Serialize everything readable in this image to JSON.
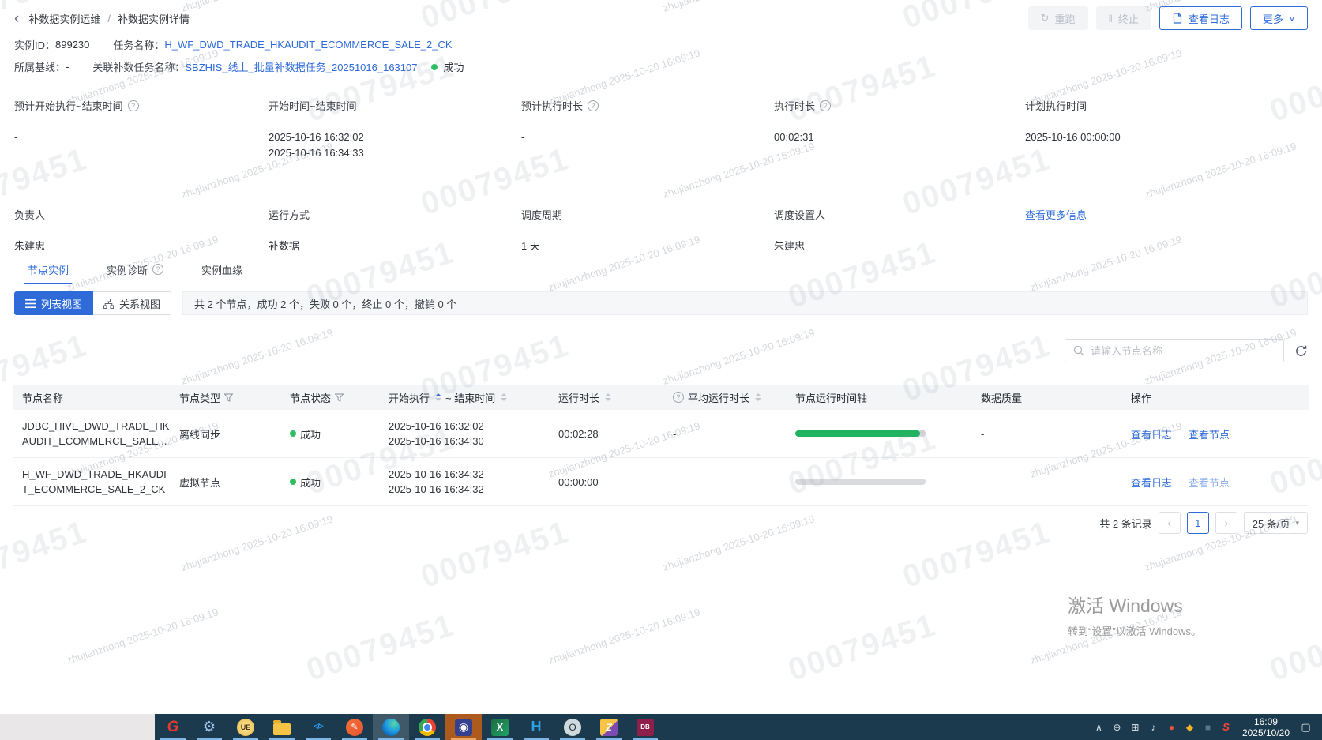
{
  "topbar": {
    "back_icon": "‹",
    "breadcrumb_section": "补数据实例运维",
    "breadcrumb_sep": "/",
    "breadcrumb_current": "补数据实例详情",
    "rerun_icon": "↻",
    "rerun_label": "重跑",
    "terminate_icon": "‖",
    "terminate_label": "终止",
    "view_log_label": "查看日志",
    "more_label": "更多",
    "more_caret": "∨"
  },
  "instance": {
    "id_label": "实例ID：",
    "id": "899230",
    "task_label": "任务名称：",
    "task_name": "H_WF_DWD_TRADE_HKAUDIT_ECOMMERCE_SALE_2_CK",
    "baseline_label": "所属基线：",
    "baseline": "-",
    "related_label": "关联补数任务名称：",
    "related_name": "SBZHIS_线上_批量补数据任务_20251016_163107",
    "status": "成功"
  },
  "info": {
    "help": "?",
    "more_link": "查看更多信息",
    "r1c1": {
      "label": "预计开始执行~结束时间",
      "v1": "-"
    },
    "r1c2": {
      "label": "开始时间~结束时间",
      "v1": "2025-10-16 16:32:02",
      "v2": "2025-10-16 16:34:33"
    },
    "r1c3": {
      "label": "预计执行时长",
      "v1": "-"
    },
    "r1c4": {
      "label": "执行时长",
      "v1": "00:02:31"
    },
    "r1c5": {
      "label": "计划执行时间",
      "v1": "2025-10-16 00:00:00"
    },
    "r2c1": {
      "label": "负责人",
      "v1": "朱建忠"
    },
    "r2c2": {
      "label": "运行方式",
      "v1": "补数据"
    },
    "r2c3": {
      "label": "调度周期",
      "v1": "1 天"
    },
    "r2c4": {
      "label": "调度设置人",
      "v1": "朱建忠"
    }
  },
  "tabs": {
    "t1": "节点实例",
    "t2": "实例诊断",
    "t3": "实例血缘",
    "help": "?"
  },
  "toolbar": {
    "list_view": "列表视图",
    "relation_view": "关系视图",
    "summary": "共 2 个节点，成功 2 个，失败 0 个，终止 0 个，撤销 0 个"
  },
  "search": {
    "placeholder": "请输入节点名称"
  },
  "table": {
    "h_name": "节点名称",
    "h_type": "节点类型",
    "h_status": "节点状态",
    "h_start": "开始执行",
    "h_end": "~ 结束时间",
    "h_duration": "运行时长",
    "h_avg": "平均运行时长",
    "h_timeline": "节点运行时间轴",
    "h_quality": "数据质量",
    "h_actions": "操作",
    "help": "?",
    "rows": [
      {
        "name1": "JDBC_HIVE_DWD_TRADE_HK",
        "name2": "AUDIT_ECOMMERCE_SALE...",
        "type": "离线同步",
        "status": "成功",
        "start": "2025-10-16 16:32:02",
        "end": "2025-10-16 16:34:30",
        "duration": "00:02:28",
        "avg": "-",
        "quality": "-",
        "timeline_pct": 96,
        "action_log": "查看日志",
        "action_node": "查看节点"
      },
      {
        "name1": "H_WF_DWD_TRADE_HKAUDI",
        "name2": "T_ECOMMERCE_SALE_2_CK",
        "type": "虚拟节点",
        "status": "成功",
        "start": "2025-10-16 16:34:32",
        "end": "2025-10-16 16:34:32",
        "duration": "00:00:00",
        "avg": "-",
        "quality": "-",
        "timeline_pct": 0,
        "action_log": "查看日志",
        "action_node": "查看节点"
      }
    ]
  },
  "pagination": {
    "total": "共 2 条记录",
    "prev": "‹",
    "page": "1",
    "next": "›",
    "size": "25 条/页",
    "caret": "▾"
  },
  "activate": {
    "line1": "激活 Windows",
    "line2": "转到“设置”以激活 Windows。"
  },
  "watermark": {
    "id": "00079451",
    "user": "zhujianzhong 2025-10-20 16:09:19"
  },
  "taskbar": {
    "time": "16:09",
    "date": "2025/10/20",
    "icons": [
      {
        "name": "red-g-app-icon",
        "glyph": "G",
        "cls": "ic0",
        "slot": "running"
      },
      {
        "name": "gear-app-icon",
        "glyph": "⚙",
        "cls": "ic1",
        "slot": "running"
      },
      {
        "name": "ultraedit-app-icon",
        "glyph": "UE",
        "cls": "ic2",
        "slot": "running"
      },
      {
        "name": "file-explorer-icon",
        "glyph": "",
        "cls": "ic3",
        "slot": "running"
      },
      {
        "name": "vscode-app-icon",
        "glyph": "</>",
        "cls": "ic4",
        "slot": "running"
      },
      {
        "name": "pen-app-icon",
        "glyph": "✎",
        "cls": "ic5",
        "slot": "running"
      },
      {
        "name": "edge-browser-icon",
        "glyph": "",
        "cls": "ic6",
        "slot": "running hl"
      },
      {
        "name": "chrome-browser-icon",
        "glyph": "",
        "cls": "ic7",
        "slot": "running"
      },
      {
        "name": "comm-app-icon",
        "glyph": "◉",
        "cls": "ic8",
        "slot": "running hl-orange"
      },
      {
        "name": "excel-app-icon",
        "glyph": "X",
        "cls": "ic9",
        "slot": "running"
      },
      {
        "name": "blue-h-app-icon",
        "glyph": "H",
        "cls": "ic10",
        "slot": "running"
      },
      {
        "name": "tortoise-app-icon",
        "glyph": "ʘ",
        "cls": "ic11",
        "slot": "running"
      },
      {
        "name": "archive-app-icon",
        "glyph": "Z",
        "cls": "ic12",
        "slot": "running"
      },
      {
        "name": "database-app-icon",
        "glyph": "DB",
        "cls": "ic13",
        "slot": "running"
      }
    ],
    "tray": [
      {
        "name": "chevron-up-icon",
        "glyph": "∧",
        "cls": ""
      },
      {
        "name": "network-icon",
        "glyph": "⊕",
        "cls": ""
      },
      {
        "name": "input-grid-icon",
        "glyph": "⊞",
        "cls": ""
      },
      {
        "name": "volume-icon",
        "glyph": "♪",
        "cls": ""
      },
      {
        "name": "antivirus-icon",
        "glyph": "●",
        "cls": "tray-red"
      },
      {
        "name": "gold-tray-icon",
        "glyph": "◆",
        "cls": "tray-gold"
      },
      {
        "name": "dark-tray-icon",
        "glyph": "■",
        "cls": "tray-dark"
      },
      {
        "name": "sogou-icon",
        "glyph": "S",
        "cls": "tray-s"
      }
    ],
    "notification_glyph": "▢"
  }
}
